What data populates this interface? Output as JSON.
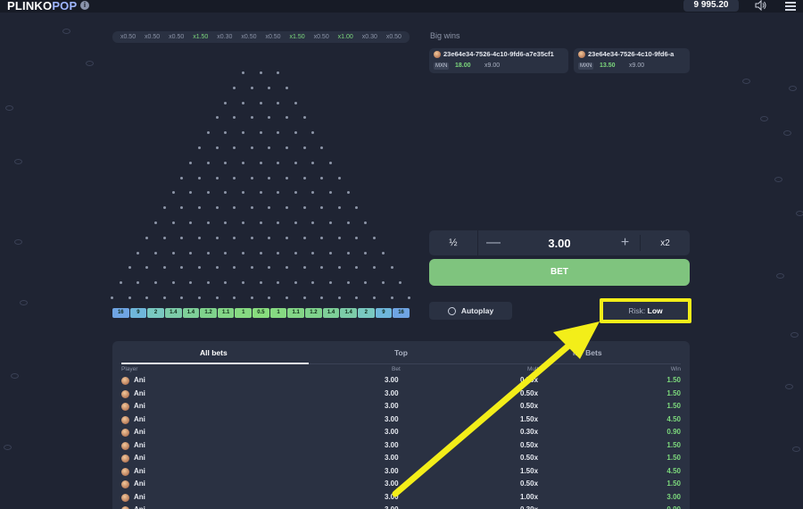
{
  "app": {
    "logo_main": "PLINKO",
    "logo_accent": "POP",
    "balance": "9 995.20"
  },
  "last_results": [
    "x0.50",
    "x0.50",
    "x0.50",
    "x1.50",
    "x0.30",
    "x0.50",
    "x0.50",
    "x1.50",
    "x0.50",
    "x1.00",
    "x0.30",
    "x0.50"
  ],
  "multipliers": [
    "16",
    "9",
    "2",
    "1.4",
    "1.4",
    "1.2",
    "1.1",
    "1",
    "0.5",
    "1",
    "1.1",
    "1.2",
    "1.4",
    "1.4",
    "2",
    "9",
    "16"
  ],
  "multiplier_colors": [
    "#6fa4e3",
    "#6fb6da",
    "#79c8c0",
    "#7ccba8",
    "#7ecf98",
    "#7fd28c",
    "#83d586",
    "#86d982",
    "#88dc7e",
    "#86d982",
    "#83d586",
    "#7fd28c",
    "#7ecf98",
    "#7ccba8",
    "#79c8c0",
    "#6fb6da",
    "#6fa4e3"
  ],
  "big_wins": {
    "title": "Big wins",
    "cards": [
      {
        "id": "23e64e34-7526-4c10-9fd6-a7e35cf1",
        "currency": "MXN",
        "amount": "18.00",
        "multiplier": "x9.00"
      },
      {
        "id": "23e64e34-7526-4c10-9fd6-a",
        "currency": "MXN",
        "amount": "13.50",
        "multiplier": "x9.00"
      }
    ]
  },
  "bet": {
    "half_label": "½",
    "amount": "3.00",
    "double_label": "x2",
    "bet_button": "BET"
  },
  "autoplay_label": "Autoplay",
  "risk": {
    "label": "Risk:",
    "value": "Low"
  },
  "bets_panel": {
    "tabs": [
      "All bets",
      "Top",
      "My Bets"
    ],
    "columns": {
      "player": "Player",
      "bet": "Bet",
      "multiplier": "Mult.",
      "win": "Win"
    },
    "rows": [
      {
        "player": "Ani",
        "bet": "3.00",
        "multiplier": "0.50x",
        "win": "1.50"
      },
      {
        "player": "Ani",
        "bet": "3.00",
        "multiplier": "0.50x",
        "win": "1.50"
      },
      {
        "player": "Ani",
        "bet": "3.00",
        "multiplier": "0.50x",
        "win": "1.50"
      },
      {
        "player": "Ani",
        "bet": "3.00",
        "multiplier": "1.50x",
        "win": "4.50"
      },
      {
        "player": "Ani",
        "bet": "3.00",
        "multiplier": "0.30x",
        "win": "0.90"
      },
      {
        "player": "Ani",
        "bet": "3.00",
        "multiplier": "0.50x",
        "win": "1.50"
      },
      {
        "player": "Ani",
        "bet": "3.00",
        "multiplier": "0.50x",
        "win": "1.50"
      },
      {
        "player": "Ani",
        "bet": "3.00",
        "multiplier": "1.50x",
        "win": "4.50"
      },
      {
        "player": "Ani",
        "bet": "3.00",
        "multiplier": "0.50x",
        "win": "1.50"
      },
      {
        "player": "Ani",
        "bet": "3.00",
        "multiplier": "1.00x",
        "win": "3.00"
      },
      {
        "player": "Ani",
        "bet": "3.00",
        "multiplier": "0.30x",
        "win": "0.90"
      }
    ]
  },
  "annotation": {
    "color": "#f3ee19"
  }
}
